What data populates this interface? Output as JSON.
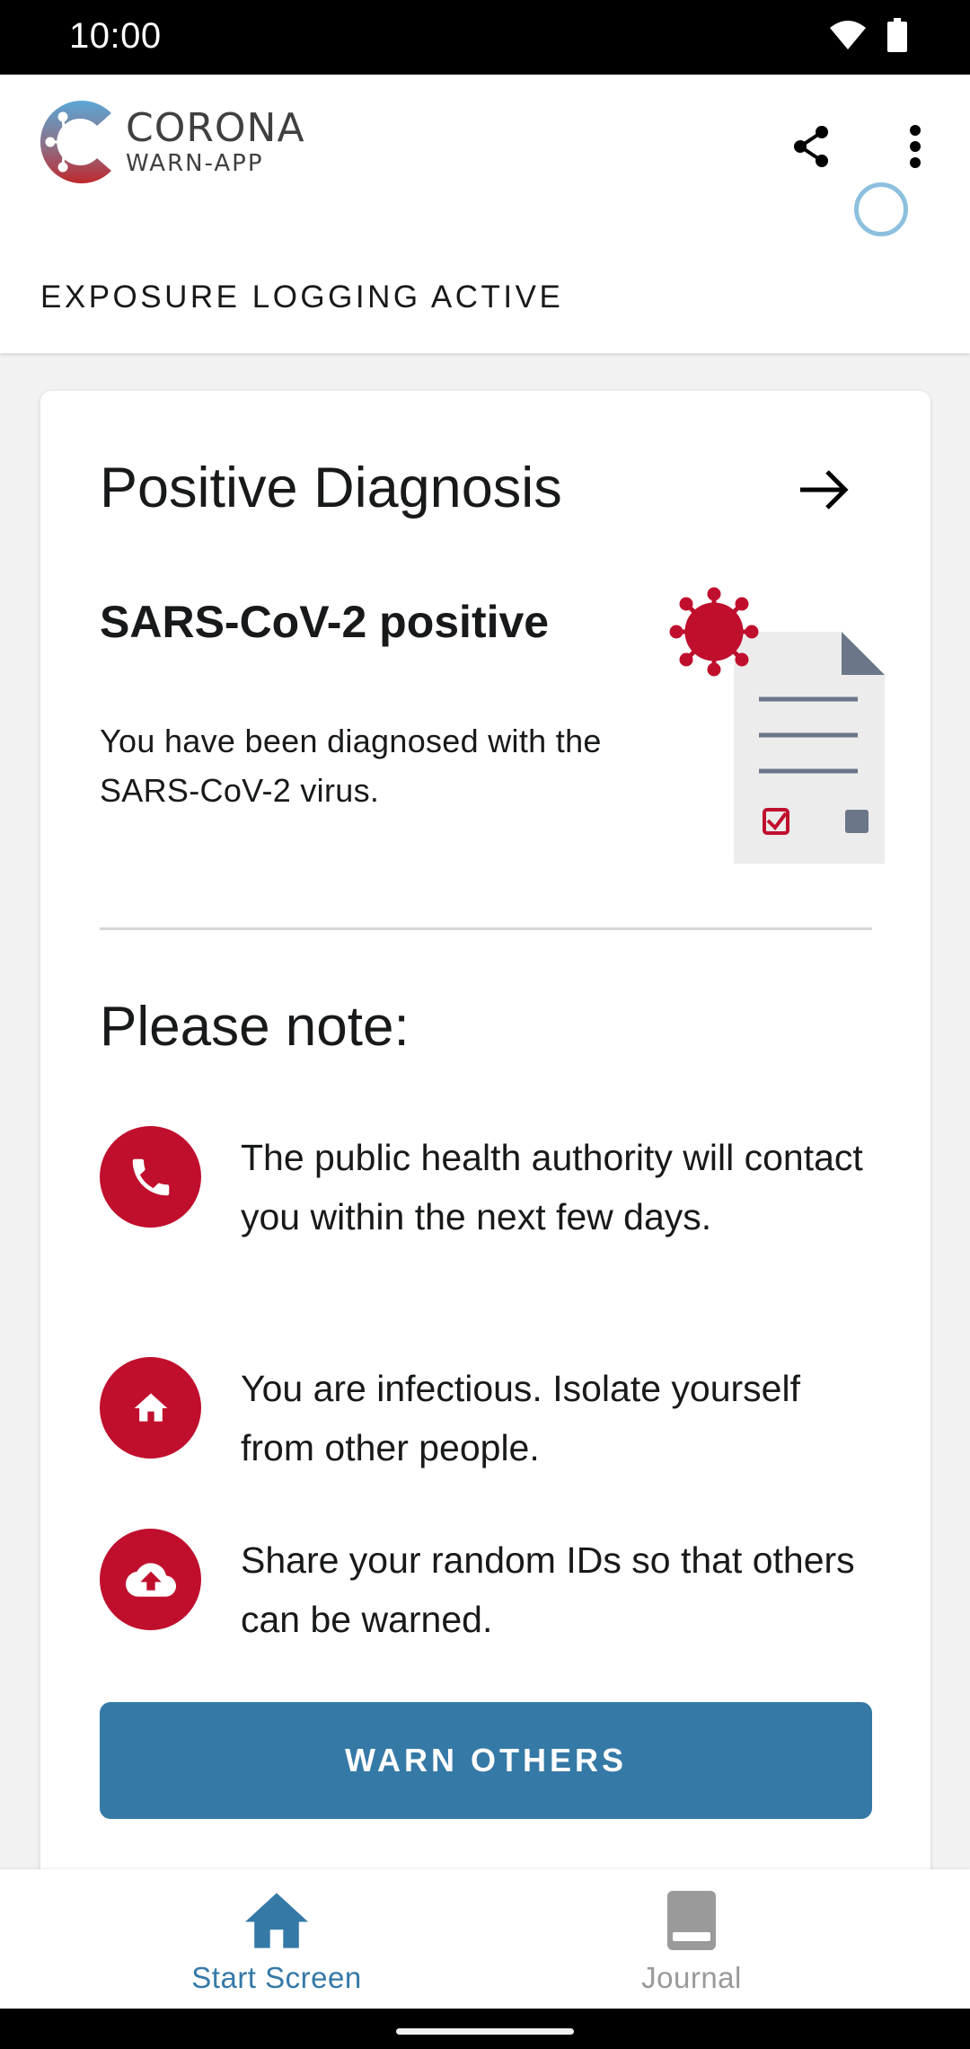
{
  "status_bar": {
    "time": "10:00"
  },
  "app": {
    "logo_title": "CORONA",
    "logo_subtitle": "WARN-APP"
  },
  "exposure": {
    "label": "EXPOSURE LOGGING ACTIVE"
  },
  "card": {
    "title": "Positive Diagnosis",
    "subtitle": "SARS-CoV-2 positive",
    "description": "You have been diagnosed with the SARS-CoV-2 virus.",
    "note_title": "Please note:",
    "notes": [
      {
        "icon": "phone-icon",
        "text": "The public health authority will contact you within the next few days."
      },
      {
        "icon": "home-icon",
        "text": "You are infectious. Isolate yourself from other people."
      },
      {
        "icon": "cloud-upload-icon",
        "text": "Share your random IDs so that others can be warned."
      }
    ],
    "button_label": "WARN OTHERS"
  },
  "bottom_nav": {
    "items": [
      {
        "label": "Start Screen",
        "icon": "home-icon",
        "active": true
      },
      {
        "label": "Journal",
        "icon": "book-icon",
        "active": false
      }
    ]
  },
  "colors": {
    "accent_blue": "#3579a6",
    "alert_red": "#c00f2d",
    "indicator_blue": "#8cc0de"
  }
}
